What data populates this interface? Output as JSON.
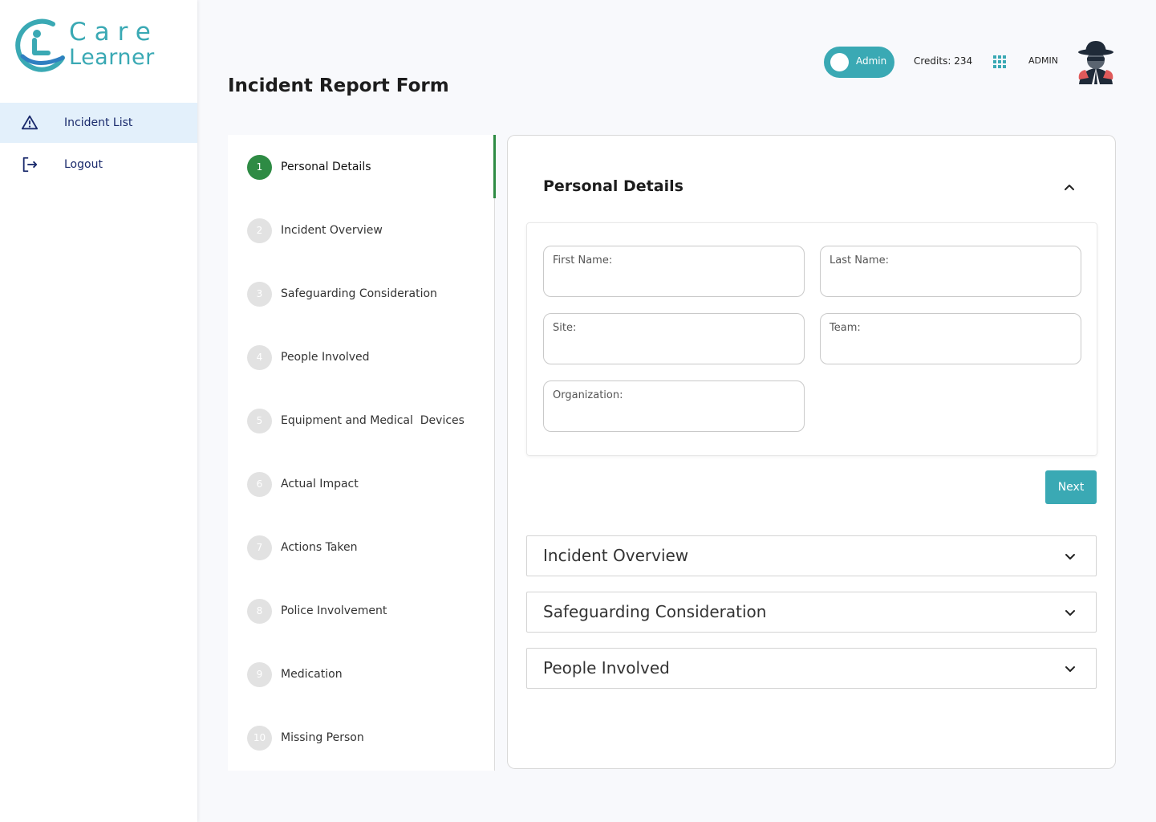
{
  "brand": {
    "line1": "Care",
    "line2": "Learner",
    "color": "#3aa9b4"
  },
  "sidebar": {
    "items": [
      {
        "label": "Incident List",
        "icon": "warning-triangle-icon",
        "active": true
      },
      {
        "label": "Logout",
        "icon": "logout-icon",
        "active": false
      }
    ]
  },
  "header": {
    "title": "Incident Report Form",
    "role_toggle_label": "Admin",
    "credits": "Credits: 234",
    "apps_icon": "grid-icon",
    "user_label": "ADMIN",
    "avatar_icon": "spy-avatar-icon"
  },
  "steps": [
    {
      "num": "1",
      "label": "Personal Details",
      "active": true
    },
    {
      "num": "2",
      "label": "Incident Overview",
      "active": false
    },
    {
      "num": "3",
      "label": "Safeguarding Consideration",
      "active": false
    },
    {
      "num": "4",
      "label": "People Involved",
      "active": false
    },
    {
      "num": "5",
      "label": "Equipment and Medical  Devices",
      "active": false
    },
    {
      "num": "6",
      "label": "Actual Impact",
      "active": false
    },
    {
      "num": "7",
      "label": "Actions Taken",
      "active": false
    },
    {
      "num": "8",
      "label": "Police Involvement",
      "active": false
    },
    {
      "num": "9",
      "label": "Medication",
      "active": false
    },
    {
      "num": "10",
      "label": "Missing Person",
      "active": false
    }
  ],
  "form": {
    "section_title": "Personal Details",
    "fields": {
      "first_name": "First Name:",
      "last_name": "Last Name:",
      "site": "Site:",
      "team": "Team:",
      "organization": "Organization:"
    },
    "next_label": "Next",
    "accordions": [
      "Incident Overview",
      "Safeguarding Consideration",
      "People Involved"
    ]
  },
  "colors": {
    "accent": "#3aa9b4",
    "step_active": "#2e8b44",
    "nav_text": "#1a2a6c"
  }
}
